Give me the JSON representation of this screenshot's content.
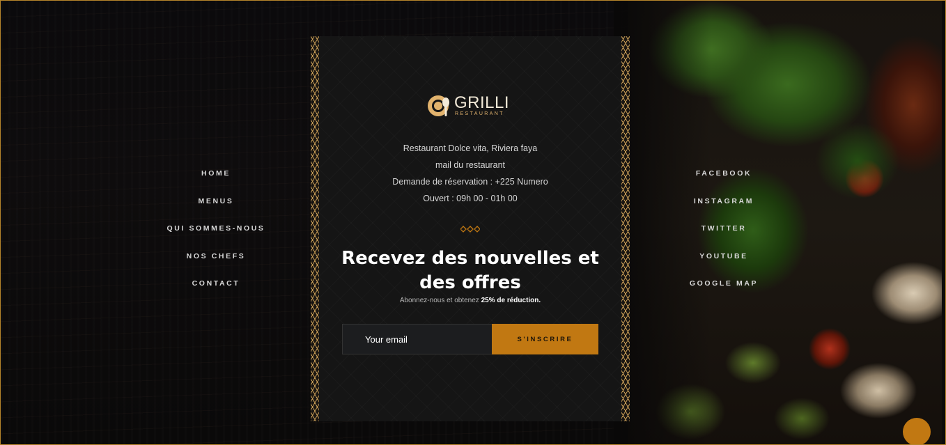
{
  "brand": {
    "name": "GRILLI",
    "subtitle": "RESTAURANT"
  },
  "nav_left": [
    "HOME",
    "MENUS",
    "QUI SOMMES-NOUS",
    "NOS CHEFS",
    "CONTACT"
  ],
  "nav_right": [
    "FACEBOOK",
    "INSTAGRAM",
    "TWITTER",
    "YOUTUBE",
    "GOOGLE MAP"
  ],
  "info": {
    "address": "Restaurant Dolce vita, Riviera faya",
    "email": "mail du restaurant",
    "phone": "Demande de réservation : +225 Numero",
    "hours": "Ouvert : 09h 00 - 01h 00"
  },
  "newsletter": {
    "title": "Recevez des nouvelles et des offres",
    "subtitle_prefix": "Abonnez-nous et obtenez",
    "subtitle_bold": "25% de réduction.",
    "email_placeholder": "Your email",
    "submit_label": "S'INSCRIRE"
  },
  "colors": {
    "accent": "#c17812",
    "gold": "#e2b36d",
    "panel": "#151515"
  },
  "icons": {
    "logo": "cloche-spoon-icon",
    "divider": "diamond-divider-icon"
  }
}
